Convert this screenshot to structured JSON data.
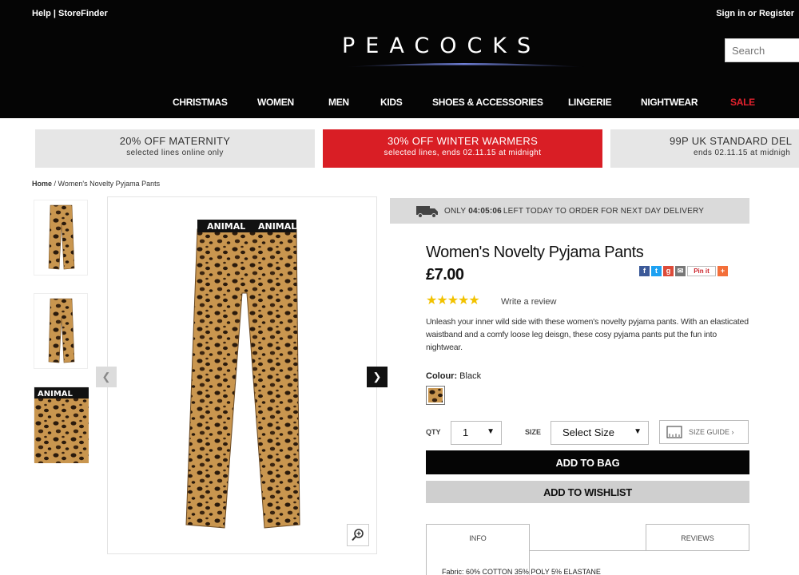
{
  "header": {
    "help": "Help",
    "separator": "|",
    "store_finder": "StoreFinder",
    "signin": "Sign in or Register",
    "logo": "PEACOCKS",
    "search_placeholder": "Search"
  },
  "nav": {
    "items": [
      "CHRISTMAS",
      "WOMEN",
      "MEN",
      "KIDS",
      "SHOES & ACCESSORIES",
      "LINGERIE",
      "NIGHTWEAR",
      "SALE"
    ]
  },
  "promos": [
    {
      "title": "20% OFF MATERNITY",
      "sub": "selected lines online only"
    },
    {
      "title": "30% OFF WINTER WARMERS",
      "sub": "selected lines, ends 02.11.15 at midnight"
    },
    {
      "title": "99P UK STANDARD DEL",
      "sub": "ends 02.11.15 at midnigh"
    }
  ],
  "breadcrumb": {
    "home": "Home",
    "separator": " / ",
    "current": "Women's Novelty Pyjama Pants"
  },
  "delivery": {
    "prefix": "ONLY",
    "time": "04:05:06",
    "text": "LEFT TODAY TO ORDER FOR NEXT DAY DELIVERY"
  },
  "product": {
    "title": "Women's Novelty Pyjama Pants",
    "price": "£7.00",
    "rating": 5,
    "stars": "★★★★★",
    "write_review": "Write a review",
    "description": "Unleash your inner wild side with these women's novelty pyjama pants. With an elasticated waistband and a comfy loose leg deisgn, these cosy pyjama pants put the fun into nightwear.",
    "colour_label": "Colour:",
    "colour_value": "Black",
    "waistband_text": "ANIMAL"
  },
  "share": {
    "pinit": "Pin it"
  },
  "purchase": {
    "qty_label": "QTY",
    "qty_value": "1",
    "size_label": "SIZE",
    "size_value": "Select Size",
    "size_guide": "SIZE GUIDE ›",
    "add_to_bag": "ADD TO BAG",
    "add_to_wishlist": "ADD TO WISHLIST"
  },
  "tabs": {
    "info": "INFO",
    "reviews": "REVIEWS"
  },
  "fabric": "Fabric: 60% COTTON 35% POLY 5% ELASTANE",
  "colors": {
    "header_bg": "#050505",
    "sale": "#e6222e",
    "promo_red": "#d91e25",
    "star": "#f2c200"
  }
}
